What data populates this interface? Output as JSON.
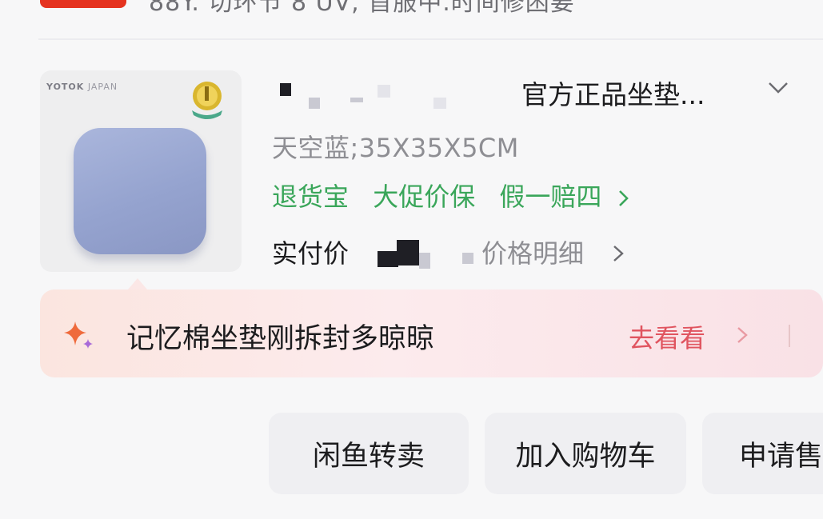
{
  "header": {
    "cut_text": "88Y. 切环节 8 UV, 首服中.时间修困要"
  },
  "product": {
    "brand_text": "YOTOK",
    "brand_sub": "JAPAN",
    "title": "官方正品坐垫...",
    "spec": "天空蓝;35X35X5CM",
    "services": [
      "退货宝",
      "大促价保",
      "假一赔四"
    ],
    "paid_label": "实付价",
    "price_detail": "价格明细"
  },
  "banner": {
    "text": "记忆棉坐垫刚拆封多晾晾",
    "action": "去看看"
  },
  "actions": {
    "resell": "闲鱼转卖",
    "add_cart": "加入购物车",
    "apply": "申请售"
  },
  "colors": {
    "green": "#3aa65a",
    "red_action": "#e0545f",
    "cushion": "#9aa7d3"
  }
}
